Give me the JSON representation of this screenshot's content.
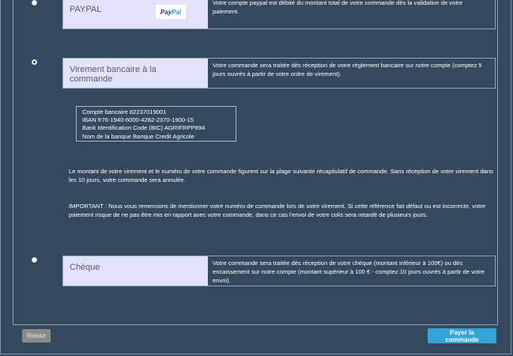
{
  "paypal": {
    "label": "PAYPAL",
    "logo_left": "Pay",
    "logo_right": "Pal",
    "description": "Votre compte paypal est débité du montant total de votre commande dès la validation de votre paiement."
  },
  "virement": {
    "label": "Virement bancaire à la commande",
    "description": "Votre commande sera traitée dès réception de votre règlement bancaire sur notre compte (comptez 5 jours ouvrés à partir de votre ordre de virement)."
  },
  "bank_details": {
    "account": "Compte bancaire 82237019001",
    "iban": "IBAN fr76-1940-6000-4282-2370-1900-15",
    "bic": "Bank Identification Code (BIC) AGRIFRPP894",
    "bank_name": "Nom de la banque Banque Credit Agricole"
  },
  "info": {
    "transfer_note": "Le montant de votre virement et le numéro de votre commande figurent sur la plage suivante récapitulatif de commande. Sans réception de votre virement dans les 10 jours, votre commande sera annulée.",
    "important_note": "IMPORTANT : Nous vous remercions de mentionner votre numéro de commande lors de votre virement. Si cette référence fait défaut ou est incorrecte, votre paiement risque de ne pas être mis en rapport avec votre commande, dans ce cas l'envoi de votre colis sera retardé de plusieurs jours."
  },
  "cheque": {
    "label": "Chèque",
    "description": "Votre commande sera traitée dès réception de votre chèque (montant inférieur à 100€) ou dès encaissement sur notre compte (montant supérieur à 100 € - comptez 10 jours ouvrés à partir de votre envoi)."
  },
  "actions": {
    "back_label": "Retour",
    "pay_label": "Payer la commande"
  }
}
